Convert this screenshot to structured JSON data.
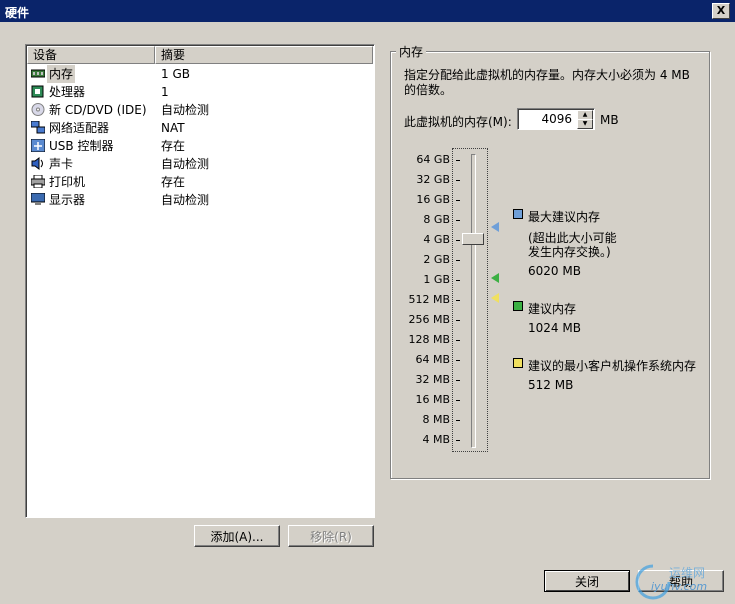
{
  "window": {
    "title": "硬件",
    "close_glyph": "X"
  },
  "table": {
    "headers": [
      "设备",
      "摘要"
    ],
    "rows": [
      {
        "name": "内存",
        "value": "1 GB",
        "icon": "memory-icon"
      },
      {
        "name": "处理器",
        "value": "1",
        "icon": "processor-icon"
      },
      {
        "name": "新 CD/DVD (IDE)",
        "value": "自动检测",
        "icon": "cd-dvd-icon"
      },
      {
        "name": "网络适配器",
        "value": "NAT",
        "icon": "network-adapter-icon"
      },
      {
        "name": "USB 控制器",
        "value": "存在",
        "icon": "usb-icon"
      },
      {
        "name": "声卡",
        "value": "自动检测",
        "icon": "sound-icon"
      },
      {
        "name": "打印机",
        "value": "存在",
        "icon": "printer-icon"
      },
      {
        "name": "显示器",
        "value": "自动检测",
        "icon": "display-icon"
      }
    ]
  },
  "buttons": {
    "add": "添加(A)...",
    "remove": "移除(R)",
    "close": "关闭",
    "help": "帮助"
  },
  "memory": {
    "group_label": "内存",
    "description_line1": "指定分配给此虚拟机的内存量。内存大小必须为 4 MB",
    "description_line2": "的倍数。",
    "field_label": "此虚拟机的内存(M):",
    "value": "4096",
    "unit": "MB",
    "scale_labels": [
      "64 GB",
      "32 GB",
      "16 GB",
      "8 GB",
      "4 GB",
      "2 GB",
      "1 GB",
      "512 MB",
      "256 MB",
      "128 MB",
      "64 MB",
      "32 MB",
      "16 MB",
      "8 MB",
      "4 MB"
    ],
    "legend": {
      "max": {
        "label": "最大建议内存",
        "note1": "(超出此大小可能",
        "note2": "发生内存交换。)",
        "value": "6020 MB",
        "color": "#6f9fd8"
      },
      "recommended": {
        "label": "建议内存",
        "value": "1024 MB",
        "color": "#3cb043"
      },
      "min_guest": {
        "label": "建议的最小客户机操作系统内存",
        "value": "512 MB",
        "color": "#f0e060"
      }
    }
  },
  "watermark": {
    "text1": "运维网",
    "text2": "iyunv.com"
  }
}
